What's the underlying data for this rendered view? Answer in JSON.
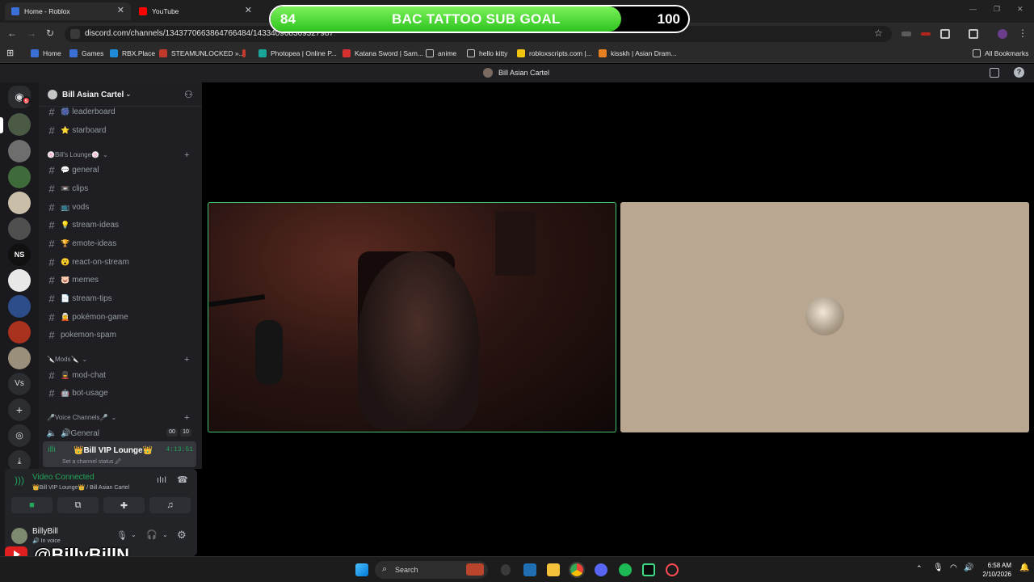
{
  "browser": {
    "tabs": [
      {
        "title": "Home - Roblox",
        "color": "#3b6fd8"
      },
      {
        "title": "YouTube",
        "color": "#ff0000"
      }
    ],
    "url": "discord.com/channels/1343770663864766484/1433409683693279877",
    "bookmarks": [
      {
        "label": "Home",
        "color": "#3b6fd8"
      },
      {
        "label": "Games",
        "color": "#3b6fd8"
      },
      {
        "label": "RBX.Place",
        "color": "#1e8bd8"
      },
      {
        "label": "STEAMUNLOCKED »...",
        "color": "#c0392b"
      },
      {
        "label": "Photopea | Online P...",
        "color": "#18a497"
      },
      {
        "label": "Katana Sword | Sam...",
        "color": "#d63031"
      },
      {
        "label": "anime",
        "color": "folder"
      },
      {
        "label": "hello kitty",
        "color": "folder"
      },
      {
        "label": "robloxscripts.com |...",
        "color": "#f1c40f"
      },
      {
        "label": "kisskh | Asian Dram...",
        "color": "#e67e22"
      }
    ],
    "all_bookmarks": "All Bookmarks"
  },
  "sub_goal": {
    "current": "84",
    "title": "BAC TATTOO SUB GOAL",
    "target": "100",
    "progress": 0.84
  },
  "discord": {
    "window_title": "Bill Asian Cartel",
    "dm_badge": "5",
    "server_name": "Bill Asian Cartel",
    "channels_top": [
      {
        "emoji": "🎆",
        "name": "leaderboard"
      },
      {
        "emoji": "⭐",
        "name": "starboard"
      }
    ],
    "category_lounge": "🍥Bill's Lounge🍥",
    "lounge_channels": [
      {
        "emoji": "💬",
        "name": "general"
      },
      {
        "emoji": "📼",
        "name": "clips"
      },
      {
        "emoji": "📺",
        "name": "vods"
      },
      {
        "emoji": "💡",
        "name": "stream-ideas"
      },
      {
        "emoji": "🏆",
        "name": "emote-ideas"
      },
      {
        "emoji": "😮",
        "name": "react-on-stream"
      },
      {
        "emoji": "🐷",
        "name": "memes"
      },
      {
        "emoji": "📄",
        "name": "stream-tips"
      },
      {
        "emoji": "🧝",
        "name": "pokémon-game"
      },
      {
        "emoji": "",
        "name": "pokemon-spam"
      }
    ],
    "category_mods": "🔪Mods🔪",
    "mod_channels": [
      {
        "emoji": "💂",
        "name": "mod-chat"
      },
      {
        "emoji": "🤖",
        "name": "bot-usage"
      }
    ],
    "category_voice": "🎤Voice Channels🎤",
    "voice_general": "🔊General",
    "voice_general_counts": [
      "00",
      "10"
    ],
    "voice_vip": "👑Bill VIP Lounge👑",
    "voice_vip_time": "4:13:51",
    "voice_vip_status": "Set a channel status 🖉",
    "video_connected": "Video Connected",
    "voice_location": "👑Bill VIP Lounge👑 / Bill Asian Cartel",
    "username": "BillyBill",
    "user_status": "🔊 In voice"
  },
  "overlay": {
    "handle": "@BillyBillN"
  },
  "taskbar": {
    "search_label": "Search",
    "time": "6:58 AM",
    "date": "2/10/2026"
  }
}
